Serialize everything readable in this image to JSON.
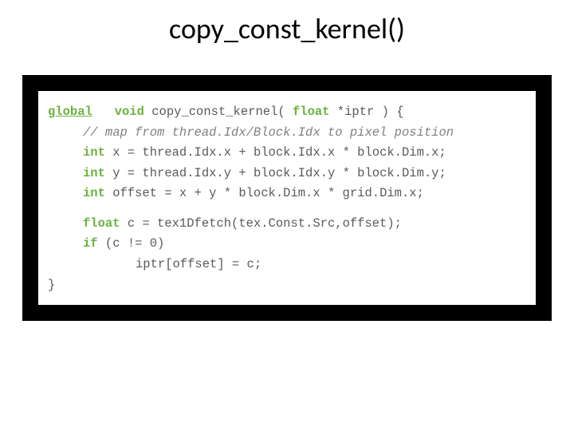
{
  "title": "copy_const_kernel()",
  "code": {
    "kw_global": "global",
    "kw_void": "void",
    "kw_float": "float",
    "kw_int": "int",
    "kw_if": "if",
    "sig_fn": " copy_const_kernel( ",
    "sig_param": " *iptr ) {",
    "comment": "// map from thread.Idx/Block.Idx to pixel position",
    "x_lhs": " x = ",
    "x_rhs": "thread.Idx.x + block.Idx.x * block.Dim.x;",
    "y_lhs": " y = ",
    "y_rhs": "thread.Idx.y + block.Idx.y * block.Dim.y;",
    "off_lhs": " offset = ",
    "off_rhs": "x + y * block.Dim.x * grid.Dim.x;",
    "c_lhs": " c = ",
    "c_rhs": "tex1Dfetch(tex.Const.Src,offset);",
    "if_cond": " (c != 0)",
    "assign": "iptr[offset] = c;",
    "brace": "}"
  }
}
